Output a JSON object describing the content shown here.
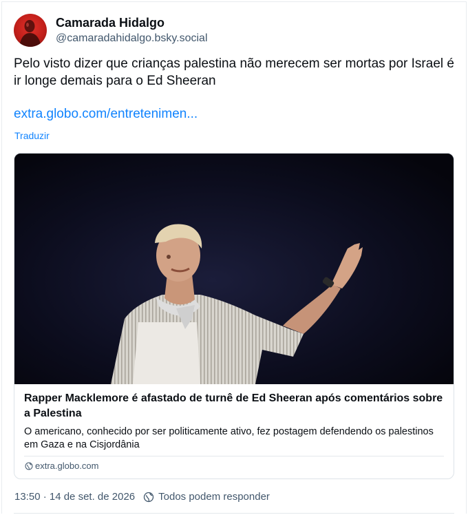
{
  "author": {
    "display_name": "Camarada Hidalgo",
    "handle": "@camaradahidalgo.bsky.social"
  },
  "post": {
    "text": "Pelo visto dizer que crianças palestina não merecem ser mortas por Israel é ir longe demais para o Ed Sheeran",
    "link": "extra.globo.com/entretenimen...",
    "translate_label": "Traduzir"
  },
  "embed": {
    "title": "Rapper Macklemore é afastado de turnê de Ed Sheeran após comentários sobre a Palestina",
    "description": "O americano, conhecido por ser politicamente ativo, fez postagem defendendo os palestinos em Gaza e na Cisjordânia",
    "domain": "extra.globo.com"
  },
  "footer": {
    "timestamp": "13:50 · 14 de set. de 2026",
    "reply_setting": "Todos podem responder"
  },
  "icons": {
    "avatar": "avatar-silhouette",
    "domain": "globe-icon",
    "reply": "globe-reply-icon"
  },
  "colors": {
    "link": "#1083fe",
    "muted": "#42576c",
    "avatar_red": "#c21f1a"
  }
}
